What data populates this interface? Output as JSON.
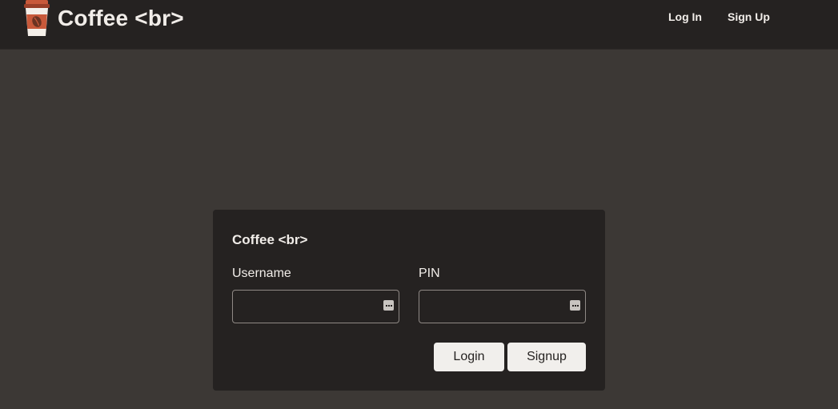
{
  "navbar": {
    "brand_text": "Coffee <br>",
    "logo_icon": "coffee-cup-icon",
    "links": [
      {
        "label": "Log In"
      },
      {
        "label": "Sign Up"
      }
    ]
  },
  "login_card": {
    "title": "Coffee <br>",
    "username": {
      "label": "Username",
      "value": "",
      "placeholder": ""
    },
    "pin": {
      "label": "PIN",
      "value": "",
      "placeholder": ""
    },
    "autofill_icon": "password-manager-key-icon",
    "buttons": {
      "login_label": "Login",
      "signup_label": "Signup"
    }
  },
  "colors": {
    "page_background": "#3c3835",
    "navbar_background": "#252221",
    "card_background": "#252221",
    "text": "#f1ede9",
    "button_background": "#f1efec",
    "input_border": "#8f8985",
    "logo_accent": "#c8593a"
  }
}
